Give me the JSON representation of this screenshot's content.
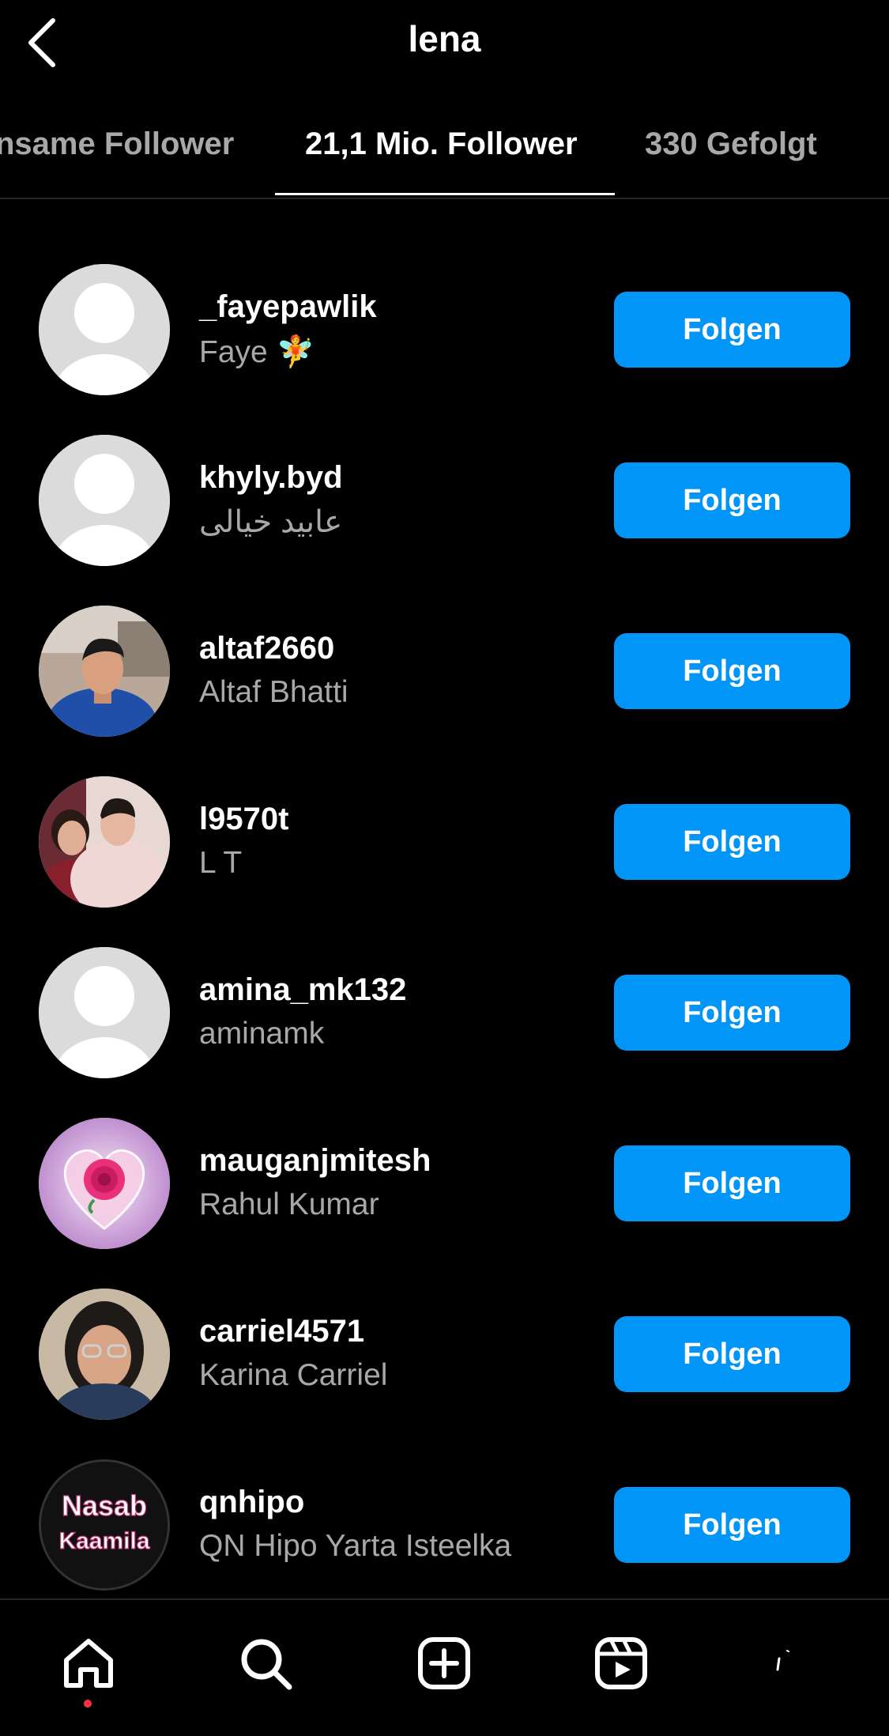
{
  "header": {
    "title": "lena",
    "back_icon": "chevron-left-icon"
  },
  "tabs": [
    {
      "label": "nsame Follower",
      "active": false
    },
    {
      "label": "21,1 Mio. Follower",
      "active": true
    },
    {
      "label": "330 Gefolgt",
      "active": false
    }
  ],
  "followers": [
    {
      "username": "_fayepawlik",
      "fullname": "Faye 🧚",
      "avatar": "default-avatar",
      "button": "Folgen"
    },
    {
      "username": "khyly.byd",
      "fullname": "عابید خیالی",
      "avatar": "default-avatar",
      "button": "Folgen"
    },
    {
      "username": "altaf2660",
      "fullname": "Altaf Bhatti",
      "avatar": "photo-man",
      "button": "Folgen"
    },
    {
      "username": "l9570t",
      "fullname": "L T",
      "avatar": "photo-couple",
      "button": "Folgen"
    },
    {
      "username": "amina_mk132",
      "fullname": "aminamk",
      "avatar": "default-avatar",
      "button": "Folgen"
    },
    {
      "username": "mauganjmitesh",
      "fullname": "Rahul Kumar",
      "avatar": "photo-rose-heart",
      "button": "Folgen"
    },
    {
      "username": "carriel4571",
      "fullname": "Karina Carriel",
      "avatar": "photo-woman-glasses",
      "button": "Folgen"
    },
    {
      "username": "qnhipo",
      "fullname": "QN Hipo Yarta Isteelka",
      "avatar": "logo-nasab-kaamila",
      "avatar_text_1": "Nasab",
      "avatar_text_2": "Kaamila",
      "button": "Folgen"
    }
  ],
  "nav": {
    "items": [
      "home-icon",
      "search-icon",
      "create-icon",
      "reels-icon",
      "profile-icon"
    ],
    "active": "home-icon",
    "notification_color": "#ff3040"
  },
  "colors": {
    "background": "#000000",
    "button": "#0095f6",
    "secondary_text": "#a8a8a8",
    "divider": "#262626"
  }
}
